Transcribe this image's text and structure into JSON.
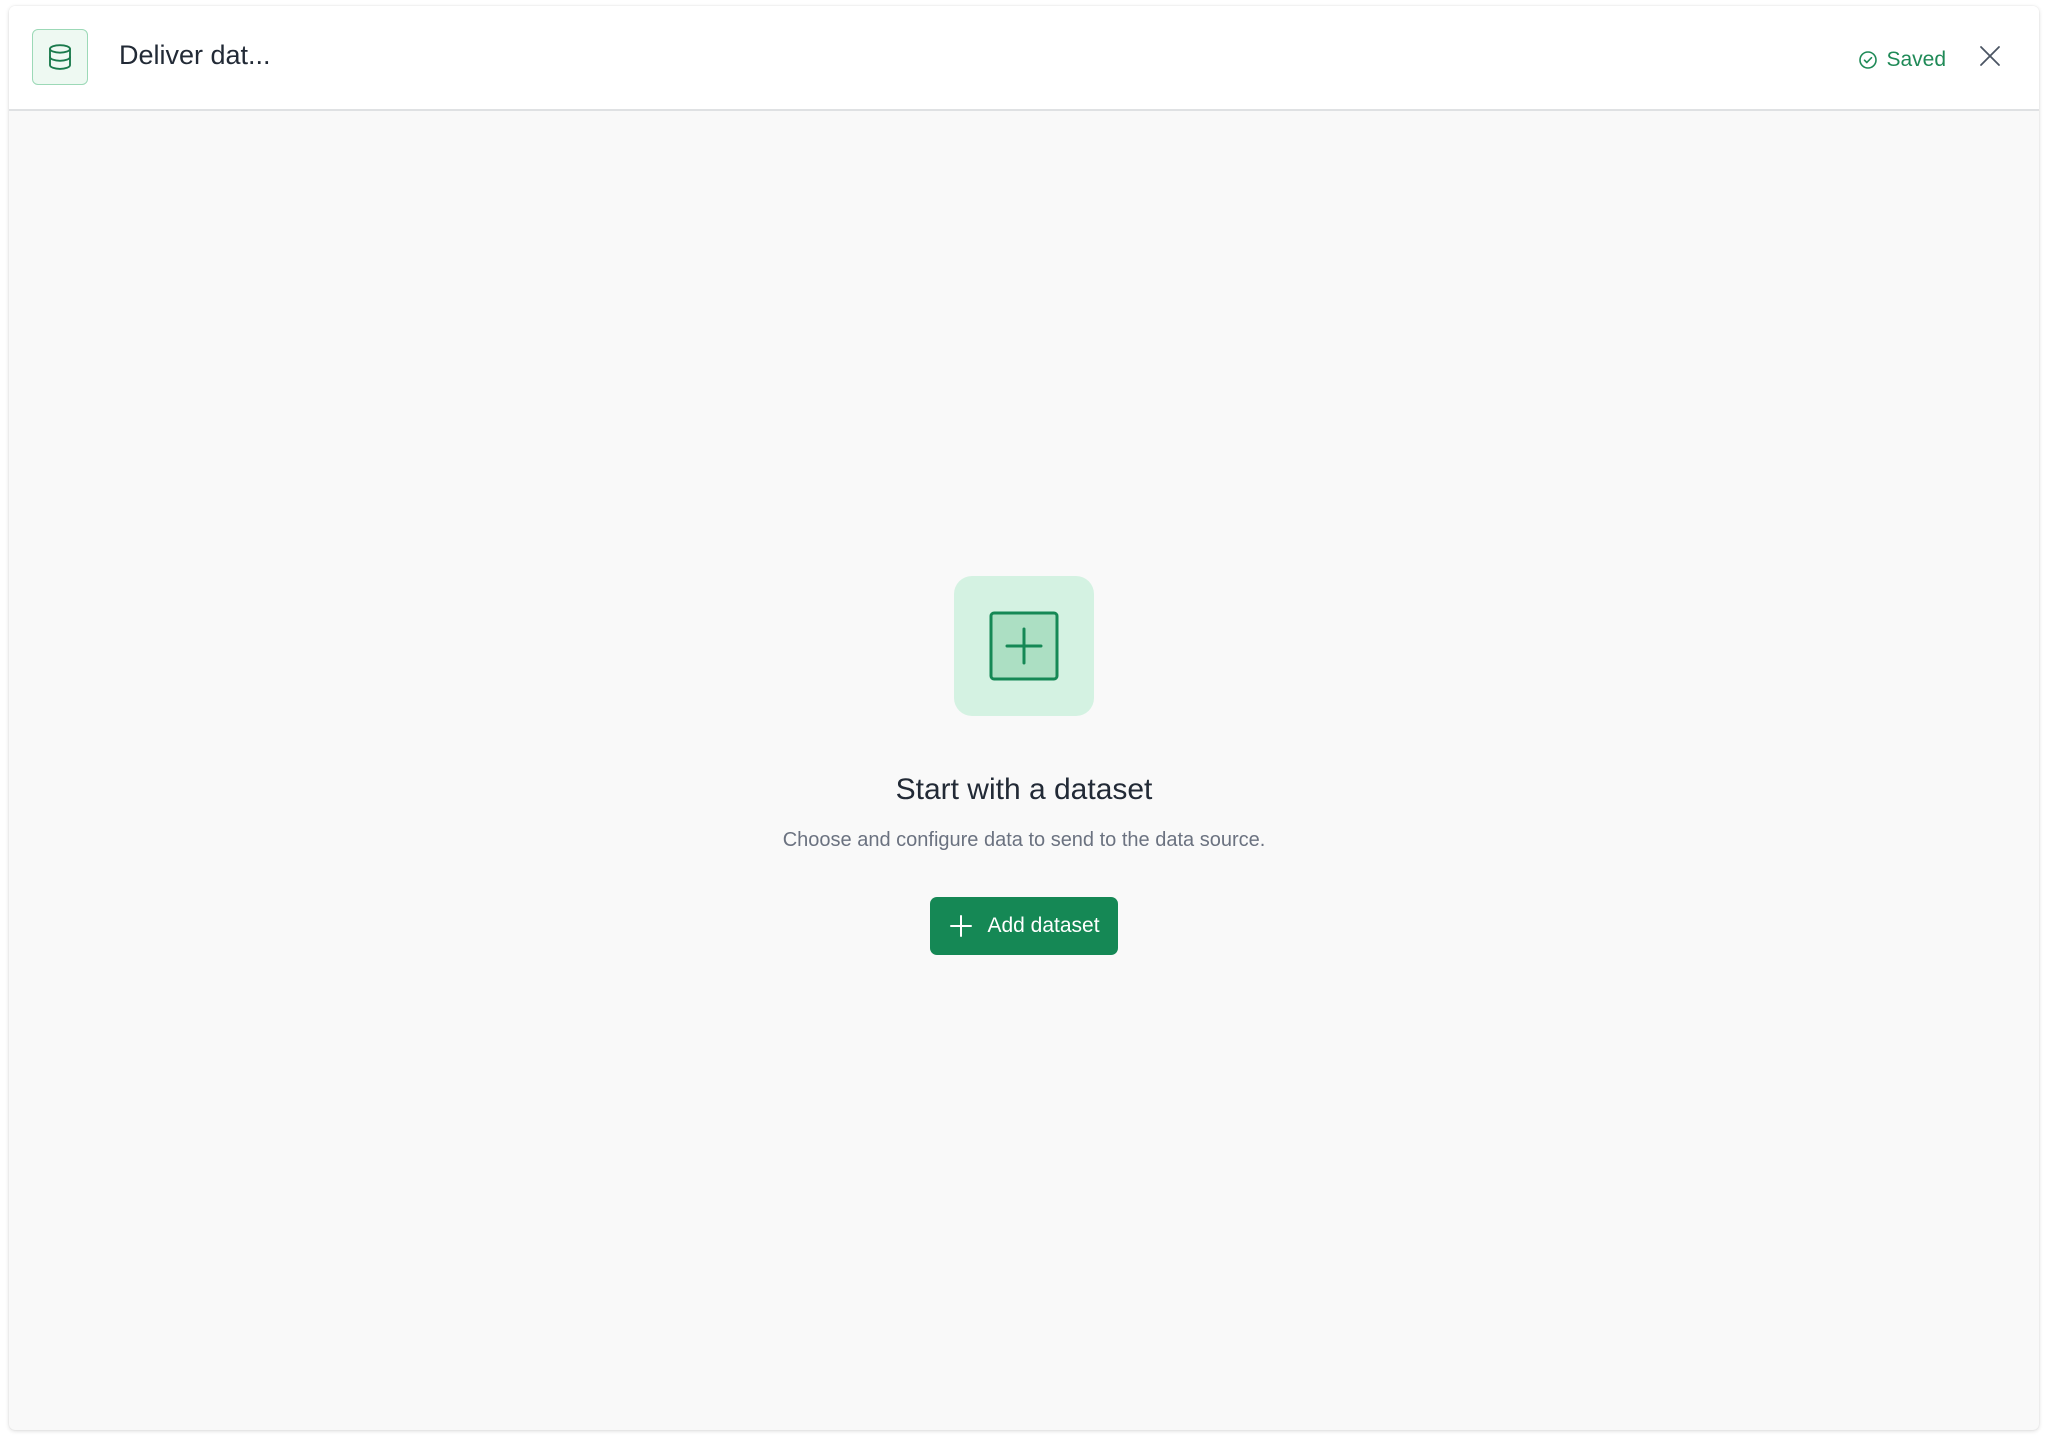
{
  "header": {
    "title": "Deliver dat...",
    "status": "Saved",
    "icon": "database-icon"
  },
  "empty_state": {
    "icon": "plus-square-icon",
    "title": "Start with a dataset",
    "description": "Choose and configure data to send to the data source.",
    "button_label": "Add dataset",
    "button_icon": "plus-icon"
  },
  "colors": {
    "accent": "#158855",
    "accent_light": "#d4f2e2",
    "status_text": "#1f8a57"
  }
}
